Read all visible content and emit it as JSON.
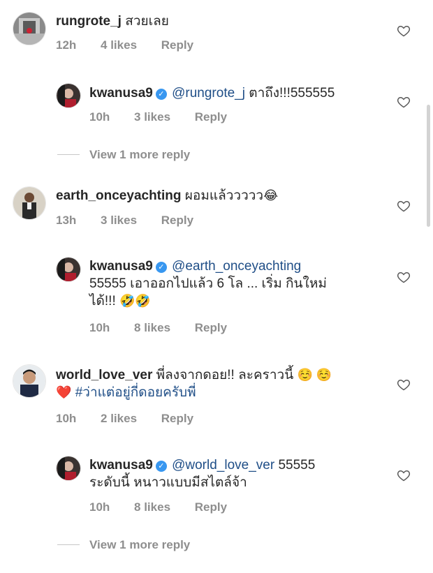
{
  "comments": [
    {
      "username": "rungrote_j",
      "text": "สวยเลย",
      "time": "12h",
      "likes": "4 likes",
      "reply": "Reply"
    },
    {
      "username": "kwanusa9",
      "mention": "@rungrote_j",
      "text": "ตาถึง!!!555555",
      "time": "10h",
      "likes": "3 likes",
      "reply": "Reply"
    },
    {
      "view_more": "View 1 more reply"
    },
    {
      "username": "earth_onceyachting",
      "text": "ผอมแล้ววววว",
      "emoji": "😂",
      "time": "13h",
      "likes": "3 likes",
      "reply": "Reply"
    },
    {
      "username": "kwanusa9",
      "mention": "@earth_onceyachting",
      "text_line2": "55555 เอาออกไปแล้ว 6 โล ... เริ่ม กินใหม่",
      "text_line3": "ได้!!!",
      "emoji": "🤣🤣",
      "time": "10h",
      "likes": "8 likes",
      "reply": "Reply"
    },
    {
      "username": "world_love_ver",
      "text": "พี่ลงจากดอย!! ละคราวนี้",
      "emoji1": "☺️ ☺️",
      "emoji2": "❤️",
      "hashtag": "#ว่าแต่อยู่กี่ดอยครับพี่",
      "time": "10h",
      "likes": "2 likes",
      "reply": "Reply"
    },
    {
      "username": "kwanusa9",
      "mention": "@world_love_ver",
      "text": "55555",
      "text_line2": "ระดับนี้ หนาวแบบมีสไตล์จ้า",
      "time": "10h",
      "likes": "8 likes",
      "reply": "Reply"
    },
    {
      "view_more": "View 1 more reply"
    }
  ],
  "verified_badge": "✓",
  "colors": {
    "mention": "#1f4e87",
    "meta": "#8e8e8e",
    "verified": "#3897f0"
  }
}
